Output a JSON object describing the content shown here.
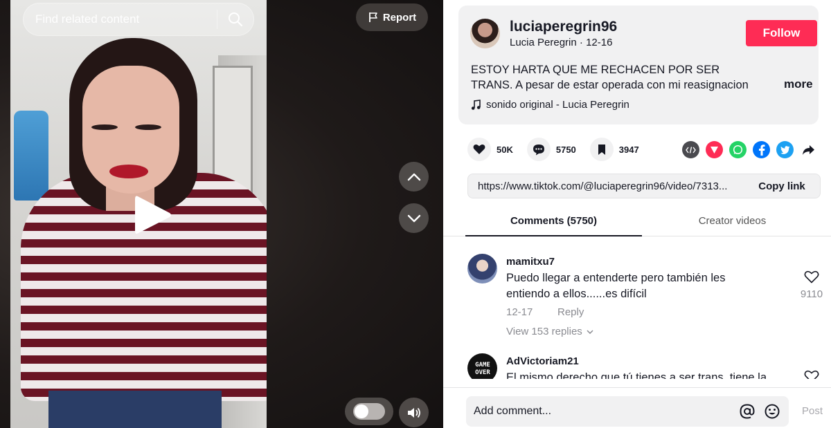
{
  "video": {
    "search_placeholder": "Find related content",
    "report_label": "Report"
  },
  "author": {
    "username": "luciaperegrin96",
    "display_name": "Lucia Peregrin",
    "date": "12-16",
    "follow_label": "Follow"
  },
  "description": {
    "text": "ESTOY HARTA QUE ME RECHACEN POR SER TRANS. A pesar de estar operada con mi reasignacion y dar por...",
    "more_label": "more",
    "music": "sonido original - Lucia Peregrin"
  },
  "stats": {
    "likes": "50K",
    "comments": "5750",
    "saves": "3947"
  },
  "share": {
    "icons": [
      "embed-icon",
      "send-icon",
      "whatsapp-icon",
      "facebook-icon",
      "twitter-icon",
      "share-arrow-icon"
    ],
    "colors": {
      "send": "#fe2c55",
      "whatsapp": "#25d366",
      "facebook": "#0075fa",
      "twitter": "#1da1f2",
      "embed": "#4a4a4f"
    }
  },
  "link": {
    "url": "https://www.tiktok.com/@luciaperegrin96/video/7313...",
    "copy_label": "Copy link"
  },
  "tabs": {
    "comments_label": "Comments (5750)",
    "creator_label": "Creator videos"
  },
  "comments": [
    {
      "user": "mamitxu7",
      "text": "Puedo llegar a entenderte pero también les entiendo a ellos......es difícil",
      "date": "12-17",
      "reply_label": "Reply",
      "replies_label": "View 153 replies",
      "likes": "9110"
    },
    {
      "user": "AdVictoriam21",
      "text": "El mismo derecho que tú tienes a ser trans, tiene la"
    }
  ],
  "comment_box": {
    "placeholder": "Add comment...",
    "post_label": "Post"
  },
  "colors": {
    "accent": "#fe2c55",
    "text": "#161823",
    "muted": "#8a8b91"
  }
}
